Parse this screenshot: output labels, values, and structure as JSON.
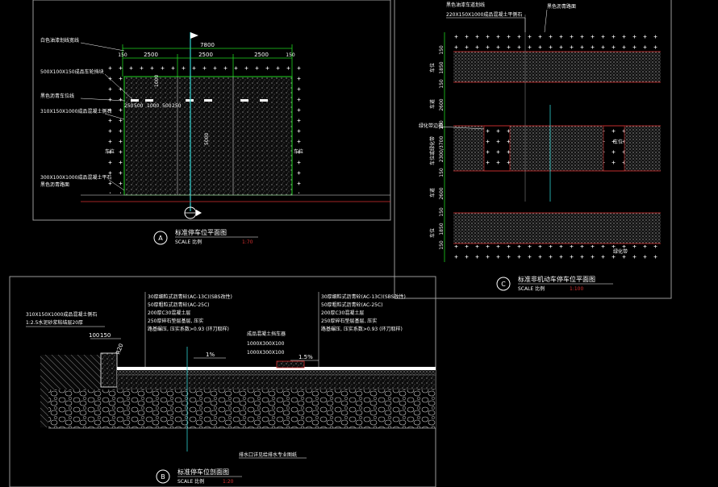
{
  "plan_a": {
    "dims": {
      "total": "7800",
      "left_150": "150",
      "bay1": "2500",
      "bay2": "2500",
      "bay3": "2500",
      "right_150": "150",
      "v1000": "1000",
      "d250": "250",
      "d500a": "500",
      "d1000": "1000",
      "d500b": "500",
      "d250b": "250",
      "d5000": "5000"
    },
    "callouts": {
      "c1": "白色油漆划线宽线",
      "c2": "500X100X150成品车轮挡块",
      "c3": "黑色沥青车位线",
      "c4": "310X150X1000成品混凝土侧石",
      "c5": "300X100X1000成品混凝土平石",
      "c6": "黑色沥青路面",
      "side_l": "车位",
      "side_r": "车位"
    },
    "title_marker": "A",
    "title": "标准停车位平面图",
    "scale_label": "SCALE 比例",
    "scale_value": "1:70"
  },
  "plan_c": {
    "top_callouts": {
      "c1": "黑色油漆车道划线",
      "c2": "220X150X1000成品混凝土平侧石",
      "c3": "黑色沥青路面"
    },
    "left_dims": [
      "150",
      "1850",
      "150",
      "2600",
      "150",
      "2300/3700",
      "150",
      "2600",
      "150",
      "1850",
      "150"
    ],
    "left_labels": [
      "车位",
      "车道",
      "车位或绿化带",
      "车道",
      "车位"
    ],
    "mid_callout": "绿化带边石",
    "mid_label": "车位",
    "bottom_label": "绿化带",
    "title_marker": "C",
    "title": "标准非机动车停车位平面图",
    "scale_label": "SCALE 比例",
    "scale_value": "1:100"
  },
  "section_b": {
    "layers_left": [
      "30厚细粒式沥青砼(AC-13C)(SBS改性)",
      "50厚粗粒式沥青砼(AC-25C)",
      "200厚C30混凝土层",
      "250厚碎石垫层基层, 压实",
      "路基碾压, 压实系数>0.93 (环刀取样)"
    ],
    "layers_right": [
      "30厚细粒式沥青砼(AC-13C)(SBS改性)",
      "50厚粗粒式沥青砼(AC-25C)",
      "200厚C30混凝土层",
      "250厚碎石垫层基层, 压实",
      "路基碾压, 压实系数>0.93 (环刀取样)"
    ],
    "kerb_callout1": "310X150X1000成品混凝土侧石",
    "kerb_callout2": "1:2.5水泥砂浆粘结层20厚",
    "mid_callout": "成品混凝土挡车器",
    "mid_sizes": [
      "1000X300X100",
      "1000X300X100"
    ],
    "dim_100": "100",
    "dim_150": "150",
    "r20": "R20",
    "slope1": "1%",
    "slope2": "1.5%",
    "bottom_callout": "排水口详见给排水专业图纸",
    "title_marker": "B",
    "title": "标准停车位剖面图",
    "scale_label": "SCALE 比例",
    "scale_value": "1:20"
  },
  "colors": {
    "frame": "#9a9a9a",
    "green": "#1fd41f",
    "white": "#ffffff",
    "cyan": "#2fd0d0",
    "red": "#d83030",
    "yellow": "#e0e040",
    "hatch": "#cfcfcf"
  }
}
